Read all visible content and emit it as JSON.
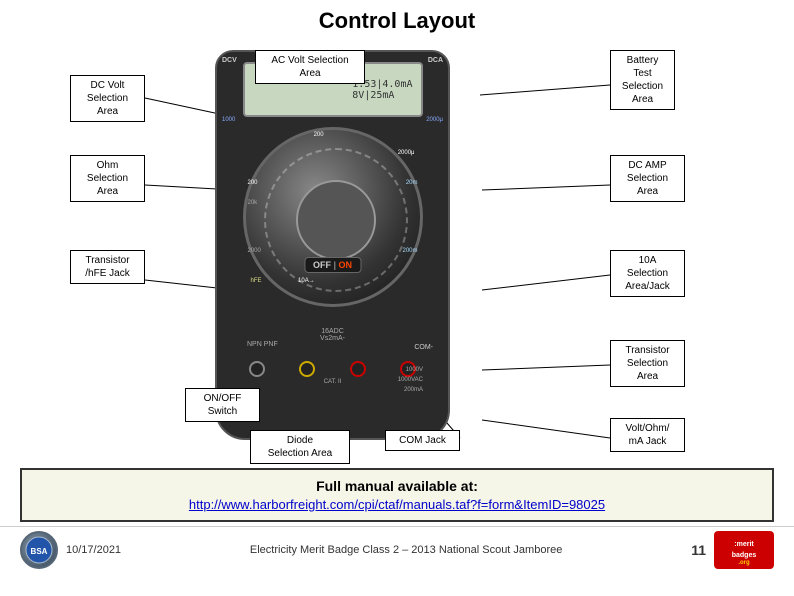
{
  "page": {
    "title": "Control Layout"
  },
  "labels": {
    "dc_volt": "DC Volt\nSelection\nArea",
    "ac_volt": "AC Volt Selection Area",
    "battery_test": "Battery\nTest\nSelection\nArea",
    "ohm": "Ohm\nSelection\nArea",
    "dc_amp": "DC AMP\nSelection\nArea",
    "transistor_hfe": "Transistor\n/hFE Jack",
    "ten_a": "10A\nSelection\nArea/Jack",
    "onoff": "ON/OFF\nSwitch",
    "transistor_sel": "Transistor\nSelection\nArea",
    "diode": "Diode\nSelection Area",
    "com_jack": "COM Jack",
    "volt_ohm": "Volt/Ohm/\nmA Jack"
  },
  "footer": {
    "date": "10/17/2021",
    "center_text": "Electricity Merit Badge Class 2 – 2013 National Scout Jamboree",
    "page_num": "11"
  },
  "bottom": {
    "title": "Full manual available at:",
    "url": "http://www.harborfreight.com/cpi/ctaf/manuals.taf?f=form&ItemID=98025"
  }
}
